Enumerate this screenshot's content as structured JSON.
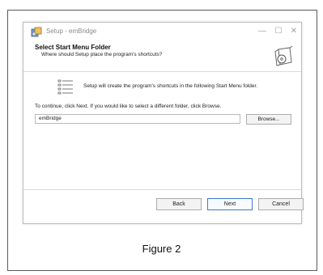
{
  "window": {
    "title": "Setup - emBridge",
    "minimize": "—",
    "maximize": "☐",
    "close": "✕"
  },
  "header": {
    "title": "Select Start Menu Folder",
    "subtitle": "Where should Setup place the program's shortcuts?"
  },
  "body": {
    "intro": "Setup will create the program's shortcuts in the following Start Menu folder.",
    "continue": "To continue, click Next. If you would like to select a different folder, click Browse.",
    "folder_value": "emBridge",
    "browse_label": "Browse..."
  },
  "buttons": {
    "back": "Back",
    "next": "Next",
    "cancel": "Cancel"
  },
  "caption": "Figure 2",
  "colors": {
    "accent": "#3b7ad8"
  },
  "icons": {
    "app": "setup-app-icon",
    "header": "cd-box-icon",
    "intro": "list-icon"
  }
}
